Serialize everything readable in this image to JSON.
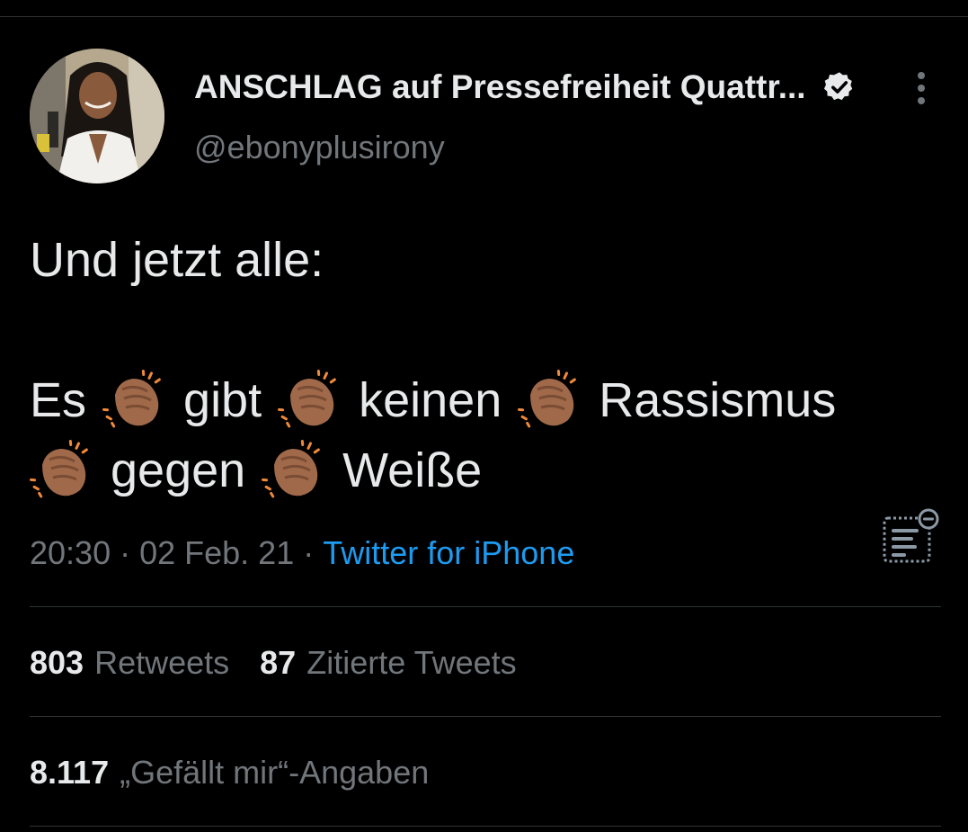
{
  "author": {
    "display_name": "ANSCHLAG auf Pressefreiheit Quattr...",
    "handle": "@ebonyplusirony",
    "verified": true
  },
  "tweet": {
    "line1": "Und jetzt alle:",
    "line3": {
      "w1": "Es",
      "w2": "gibt",
      "w3": "keinen",
      "w4": "Rassismus"
    },
    "line4": {
      "w1": "gegen",
      "w2": "Weiße"
    },
    "emoji": "clapping-hands-medium-dark-skin-tone"
  },
  "meta": {
    "time": "20:30",
    "date": "02 Feb. 21",
    "separator": "·",
    "source": "Twitter for iPhone"
  },
  "stats": {
    "retweets_count": "803",
    "retweets_label": "Retweets",
    "quotes_count": "87",
    "quotes_label": "Zitierte Tweets",
    "likes_count": "8.117",
    "likes_label": "„Gefällt mir“-Angaben"
  },
  "colors": {
    "background": "#000000",
    "text_primary": "#e7e9ea",
    "text_secondary": "#71767b",
    "link": "#1d9bf0",
    "divider": "#2f3336",
    "emoji_skin": "#a0694a"
  }
}
